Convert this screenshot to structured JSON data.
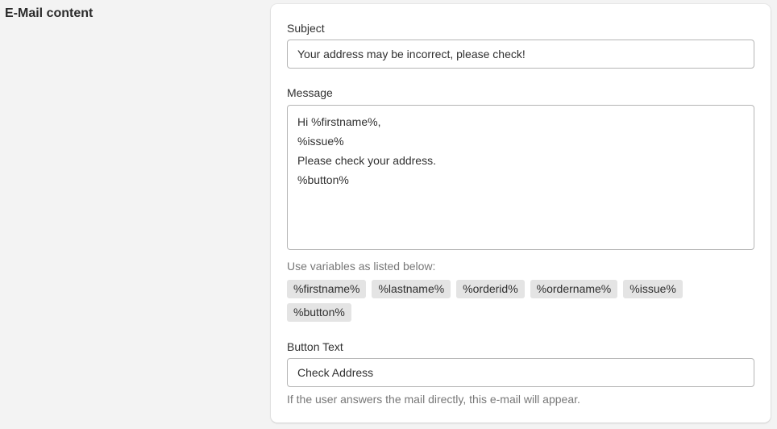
{
  "section": {
    "title": "E-Mail content"
  },
  "subject": {
    "label": "Subject",
    "value": "Your address may be incorrect, please check!"
  },
  "message": {
    "label": "Message",
    "lines": [
      "Hi %firstname%,",
      "%issue%",
      "Please check your address.",
      "%button%"
    ]
  },
  "variables": {
    "hint": "Use variables as listed below:",
    "tags": [
      "%firstname%",
      "%lastname%",
      "%orderid%",
      "%ordername%",
      "%issue%",
      "%button%"
    ]
  },
  "button_text": {
    "label": "Button Text",
    "value": "Check Address",
    "help": "If the user answers the mail directly, this e-mail will appear."
  }
}
